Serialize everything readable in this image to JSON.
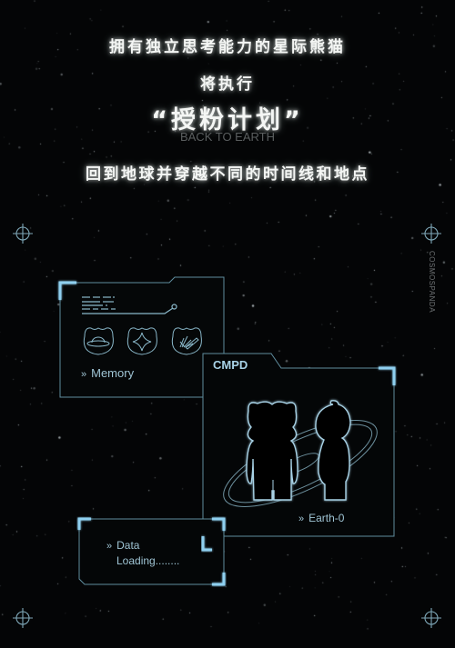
{
  "headline": {
    "line1": "拥有独立思考能力的星际熊猫",
    "line2": "将执行",
    "line3": "“授粉计划”",
    "line3_sub": "BACK TO EARTH",
    "line4": "回到地球并穿越不同的时间线和地点"
  },
  "brand_vertical": "COSMOSPANDA",
  "panels": {
    "memory": {
      "label": "Memory",
      "chevron": "»",
      "icons": [
        "planet-icon",
        "sparkle-star-icon",
        "leaf-plant-icon"
      ]
    },
    "cmpd": {
      "title": "CMPD",
      "label": "Earth-0",
      "chevron": "»"
    },
    "data": {
      "chevron": "»",
      "line1": "Data",
      "line2": "Loading........"
    }
  },
  "colors": {
    "background": "#040506",
    "accent": "#8fd0f0",
    "line": "#5f8d9e",
    "text": "#f4f6f4"
  }
}
